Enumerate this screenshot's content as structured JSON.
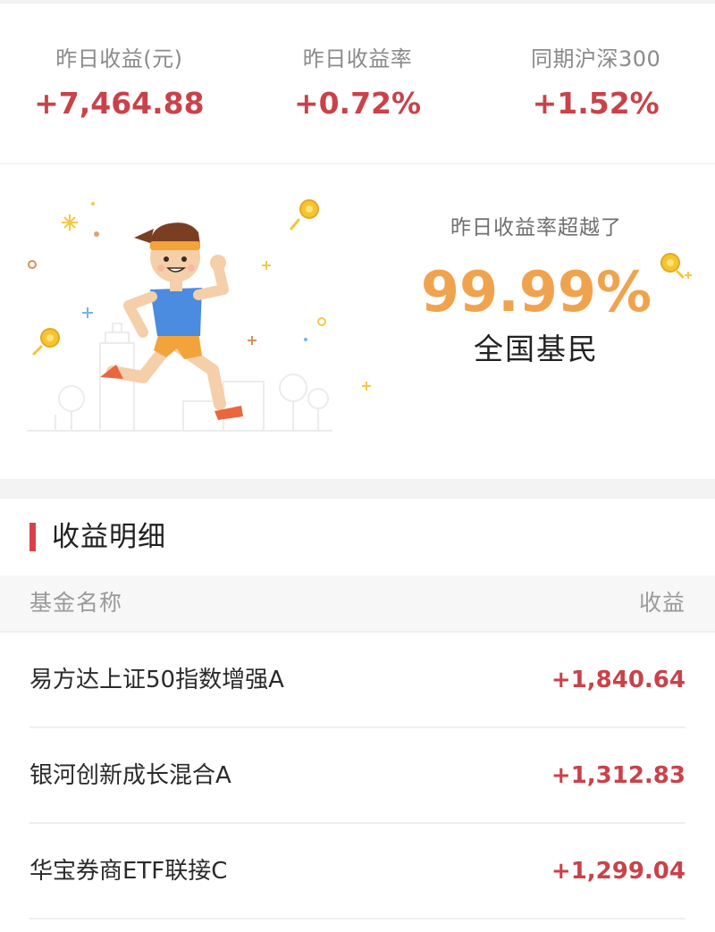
{
  "summary": {
    "stats": [
      {
        "label": "昨日收益(元)",
        "value": "+7,464.88"
      },
      {
        "label": "昨日收益率",
        "value": "+0.72%"
      },
      {
        "label": "同期沪深300",
        "value": "+1.52%"
      }
    ]
  },
  "rank": {
    "caption": "昨日收益率超越了",
    "percent": "99.99%",
    "group": "全国基民"
  },
  "detail": {
    "title": "收益明细",
    "columns": {
      "name": "基金名称",
      "earnings": "收益"
    },
    "rows": [
      {
        "name": "易方达上证50指数增强A",
        "earnings": "+1,840.64"
      },
      {
        "name": "银河创新成长混合A",
        "earnings": "+1,312.83"
      },
      {
        "name": "华宝券商ETF联接C",
        "earnings": "+1,299.04"
      }
    ]
  },
  "colors": {
    "positive": "#c9424a",
    "rank_accent": "#f0a34e",
    "section_bar": "#d94149"
  },
  "icons": [
    "runner-illustration",
    "coin-icon",
    "sparkle-icon"
  ]
}
